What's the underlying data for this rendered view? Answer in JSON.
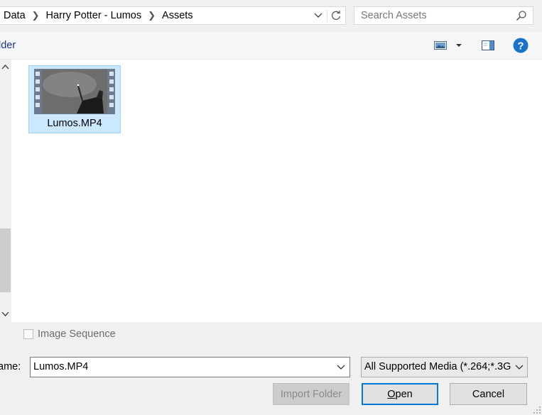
{
  "address_bar": {
    "crumbs": [
      "Data",
      "Harry Potter - Lumos",
      "Assets"
    ]
  },
  "search": {
    "placeholder": "Search Assets"
  },
  "toolbar": {
    "folder_label": "lder"
  },
  "files": [
    {
      "name": "Lumos.MP4",
      "selected": true,
      "icon": "video-thumbnail-icon"
    }
  ],
  "image_sequence": {
    "label": "Image Sequence",
    "checked": false
  },
  "file_name": {
    "label": "ame:",
    "value": "Lumos.MP4"
  },
  "file_type": {
    "value": "All Supported Media (*.264;*.3G"
  },
  "buttons": {
    "import_folder": "Import Folder",
    "open_first": "O",
    "open_rest": "pen",
    "cancel": "Cancel"
  },
  "colors": {
    "accent": "#0078d7",
    "selection": "#cce8ff",
    "help": "#1a73c9"
  }
}
